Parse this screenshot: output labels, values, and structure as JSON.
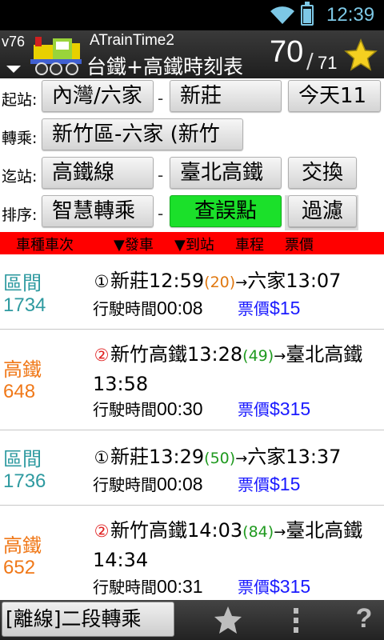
{
  "status_bar": {
    "time": "12:39",
    "wifi_icon": "wifi-icon",
    "battery_icon": "battery-icon"
  },
  "header": {
    "version": "v76",
    "app_name": "ATrainTime2",
    "subtitle": "台鐵+高鐵時刻表",
    "current": "70",
    "separator": "/",
    "total": "71",
    "logo_icon": "train-logo-icon",
    "favorite_icon": "star-icon"
  },
  "form": {
    "origin_label": "起站:",
    "origin_value": "內灣/六家",
    "dash": "-",
    "destination_value": "新莊",
    "date_value": "今天11",
    "transfer_label": "轉乘:",
    "transfer_value": "新竹區-六家 (新竹",
    "arrival_label": "迄站:",
    "arrival_line_value": "高鐵線",
    "arrival_station_value": "臺北高鐵",
    "swap_label": "交換",
    "sort_label": "排序:",
    "sort_value": "智慧轉乘",
    "check_label": "查誤點",
    "filter_label": "過濾"
  },
  "column_header": {
    "type_no": "車種車次",
    "departure": "▼發車",
    "arrival": "▼到站",
    "duration": "車程",
    "fare": "票價"
  },
  "colors": {
    "local_train": "#2e9aa0",
    "hsr": "#f07818",
    "wait_orange": "#e07810",
    "wait_green": "#1f9a1f",
    "marker_red": "#e02020",
    "fare_blue": "#1a1aff",
    "check_green": "#1be02a",
    "header_red": "#ff0000"
  },
  "trains": [
    {
      "type": "區間",
      "number": "1734",
      "type_color": "#2e9aa0",
      "marker": "①",
      "marker_color": "#000000",
      "from": "新莊",
      "dep": "12:59",
      "wait": "(20)",
      "wait_color": "#e07810",
      "arrow": "→",
      "to": "六家",
      "arr": "13:07",
      "duration_label": "行駛時間",
      "duration": "00:08",
      "fare_label": "票價",
      "fare": "$15"
    },
    {
      "type": "高鐵",
      "number": "648",
      "type_color": "#f07818",
      "marker": "②",
      "marker_color": "#e02020",
      "from": "新竹高鐵",
      "dep": "13:28",
      "wait": "(49)",
      "wait_color": "#1f9a1f",
      "arrow": "→",
      "to": "臺北高鐵",
      "arr": "13:58",
      "duration_label": "行駛時間",
      "duration": "00:30",
      "fare_label": "票價",
      "fare": "$315"
    },
    {
      "type": "區間",
      "number": "1736",
      "type_color": "#2e9aa0",
      "marker": "①",
      "marker_color": "#000000",
      "from": "新莊",
      "dep": "13:29",
      "wait": "(50)",
      "wait_color": "#1f9a1f",
      "arrow": "→",
      "to": "六家",
      "arr": "13:37",
      "duration_label": "行駛時間",
      "duration": "00:08",
      "fare_label": "票價",
      "fare": "$15"
    },
    {
      "type": "高鐵",
      "number": "652",
      "type_color": "#f07818",
      "marker": "②",
      "marker_color": "#e02020",
      "from": "新竹高鐵",
      "dep": "14:03",
      "wait": "(84)",
      "wait_color": "#1f9a1f",
      "arrow": "→",
      "to": "臺北高鐵",
      "arr": "14:34",
      "duration_label": "行駛時間",
      "duration": "00:31",
      "fare_label": "票價",
      "fare": "$315"
    }
  ],
  "bottom_bar": {
    "mode_label": "[離線]二段轉乘",
    "star_icon": "star-icon",
    "more_icon": "overflow-menu-icon",
    "help_label": "?"
  }
}
